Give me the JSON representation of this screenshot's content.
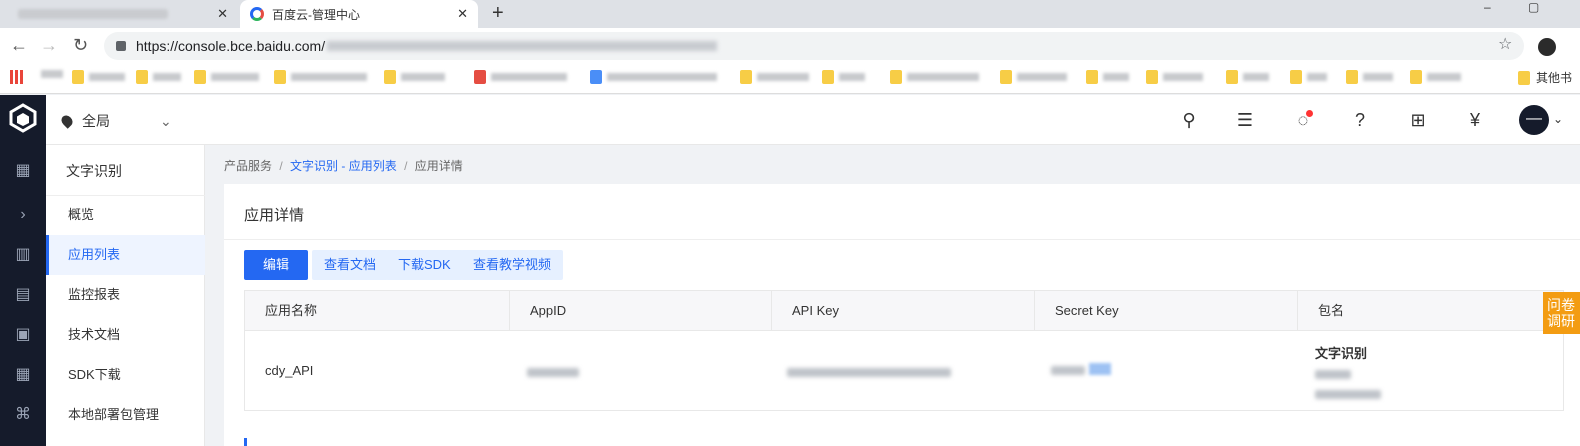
{
  "browser": {
    "active_tab_title": "百度云-管理中心",
    "url": "https://console.bce.baidu.com/",
    "bookmark_other_label": "其他书"
  },
  "header": {
    "region_label": "全局"
  },
  "sidemenu": {
    "title": "文字识别",
    "items": [
      {
        "label": "概览"
      },
      {
        "label": "应用列表"
      },
      {
        "label": "监控报表"
      },
      {
        "label": "技术文档"
      },
      {
        "label": "SDK下载"
      },
      {
        "label": "本地部署包管理"
      }
    ]
  },
  "breadcrumb": {
    "root": "产品服务",
    "middle": "文字识别 - 应用列表",
    "current": "应用详情",
    "sep": "/"
  },
  "card": {
    "title": "应用详情",
    "buttons": {
      "edit": "编辑",
      "docs": "查看文档",
      "sdk": "下载SDK",
      "video": "查看教学视频"
    },
    "table": {
      "headers": [
        "应用名称",
        "AppID",
        "API Key",
        "Secret Key",
        "包名"
      ],
      "row": {
        "app_name": "cdy_API",
        "package_title": "文字识别"
      }
    }
  },
  "float_tab": {
    "line1": "问卷",
    "line2": "调研"
  },
  "colors": {
    "brand": "#2468f2",
    "nav_dark": "#151b2b",
    "float_tab": "#f39c12"
  }
}
